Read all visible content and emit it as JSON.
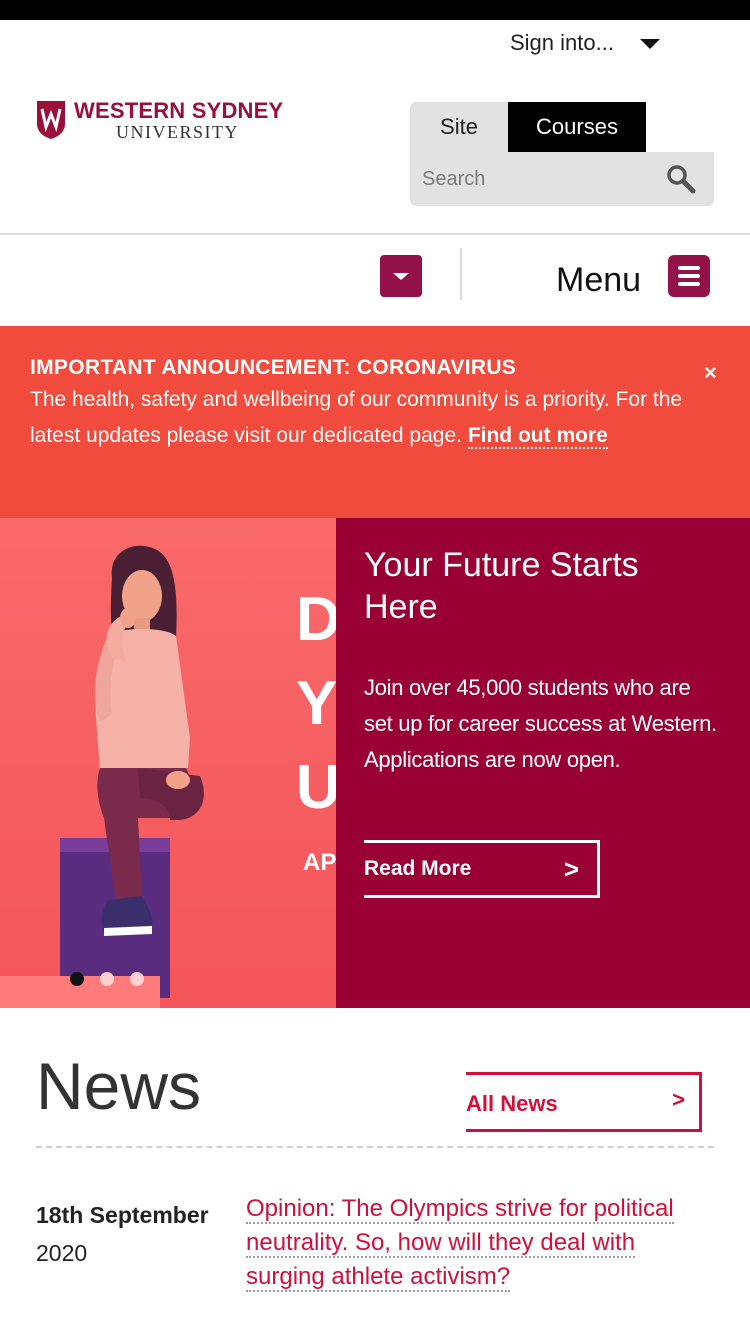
{
  "header": {
    "signin_label": "Sign into...",
    "logo_line1": "WESTERN SYDNEY",
    "logo_line2": "UNIVERSITY",
    "search_tabs": [
      "Site",
      "Courses"
    ],
    "search_placeholder": "Search",
    "menu_label": "Menu"
  },
  "announcement": {
    "title": "IMPORTANT ANNOUNCEMENT: CORONAVIRUS",
    "text": "The health, safety and wellbeing of our community is a priority. For the latest updates please visit our dedicated page.",
    "link_text": "Find out more",
    "close": "×"
  },
  "hero": {
    "title": "Your Future Starts Here",
    "text": "Join over 45,000 students who are set up for career success at Western. Applications are now open.",
    "button_label": "Read More",
    "button_chevron": ">",
    "image_letters": [
      "D",
      "Y",
      "U",
      "AP"
    ],
    "slides": 3,
    "active_slide": 1
  },
  "news": {
    "heading": "News",
    "all_news_label": "All News",
    "all_news_chevron": ">",
    "items": [
      {
        "date_day": "18th September",
        "date_year": "2020",
        "headline": "Opinion: The Olympics strive for political neutrality. So, how will they deal with surging athlete activism?"
      }
    ]
  },
  "colors": {
    "brand": "#990033",
    "announcement_bg": "#f04b3c",
    "link_red": "#d0103a"
  }
}
